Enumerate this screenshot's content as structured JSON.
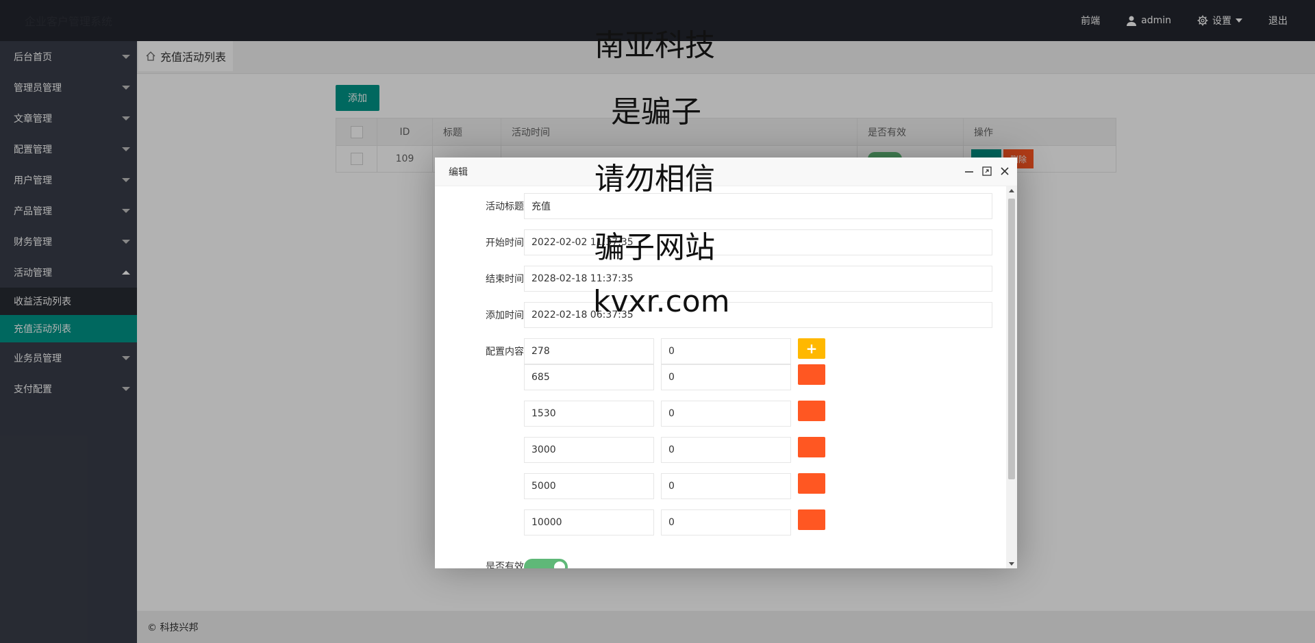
{
  "header": {
    "logo": "企业客户管理系统",
    "nav": {
      "frontend": "前端",
      "user": "admin",
      "settings": "设置",
      "logout": "退出"
    }
  },
  "sidebar": {
    "items": [
      {
        "label": "后台首页"
      },
      {
        "label": "管理员管理"
      },
      {
        "label": "文章管理"
      },
      {
        "label": "配置管理"
      },
      {
        "label": "用户管理"
      },
      {
        "label": "产品管理"
      },
      {
        "label": "财务管理"
      },
      {
        "label": "活动管理",
        "expanded": true
      },
      {
        "label": "业务员管理"
      },
      {
        "label": "支付配置"
      }
    ],
    "subitems": [
      {
        "label": "收益活动列表"
      },
      {
        "label": "充值活动列表",
        "active": true
      }
    ]
  },
  "tab": {
    "label": "充值活动列表"
  },
  "main": {
    "add_button": "添加",
    "table": {
      "headers": [
        "ID",
        "标题",
        "活动时间",
        "是否有效",
        "操作"
      ],
      "rows": [
        {
          "id": "109",
          "delete": "删除"
        }
      ]
    }
  },
  "footer": {
    "text": "© 科技兴邦"
  },
  "dialog": {
    "title": "编辑",
    "fields": {
      "title_label": "活动标题",
      "title_value": "充值",
      "start_label": "开始时间",
      "start_value": "2022-02-02 11:37:35",
      "end_label": "结束时间",
      "end_value": "2028-02-18 11:37:35",
      "add_label": "添加时间",
      "add_value": "2022-02-18 06:37:35",
      "config_label": "配置内容",
      "valid_label": "是否有效"
    },
    "config_rows": [
      {
        "amount": "278",
        "bonus": "0",
        "action": "+"
      },
      {
        "amount": "685",
        "bonus": "0",
        "action": ""
      },
      {
        "amount": "1530",
        "bonus": "0",
        "action": ""
      },
      {
        "amount": "3000",
        "bonus": "0",
        "action": ""
      },
      {
        "amount": "5000",
        "bonus": "0",
        "action": ""
      },
      {
        "amount": "10000",
        "bonus": "0",
        "action": ""
      }
    ]
  },
  "watermark": [
    "南亚科技",
    "是骗子",
    "请勿相信",
    "骗子网站",
    "kvxr.com"
  ],
  "colors": {
    "header_bg": "#23262e",
    "sidebar_bg": "#393d49",
    "accent": "#009688",
    "danger": "#ff5722",
    "warn": "#ffb800",
    "switch_on": "#5fb878"
  }
}
